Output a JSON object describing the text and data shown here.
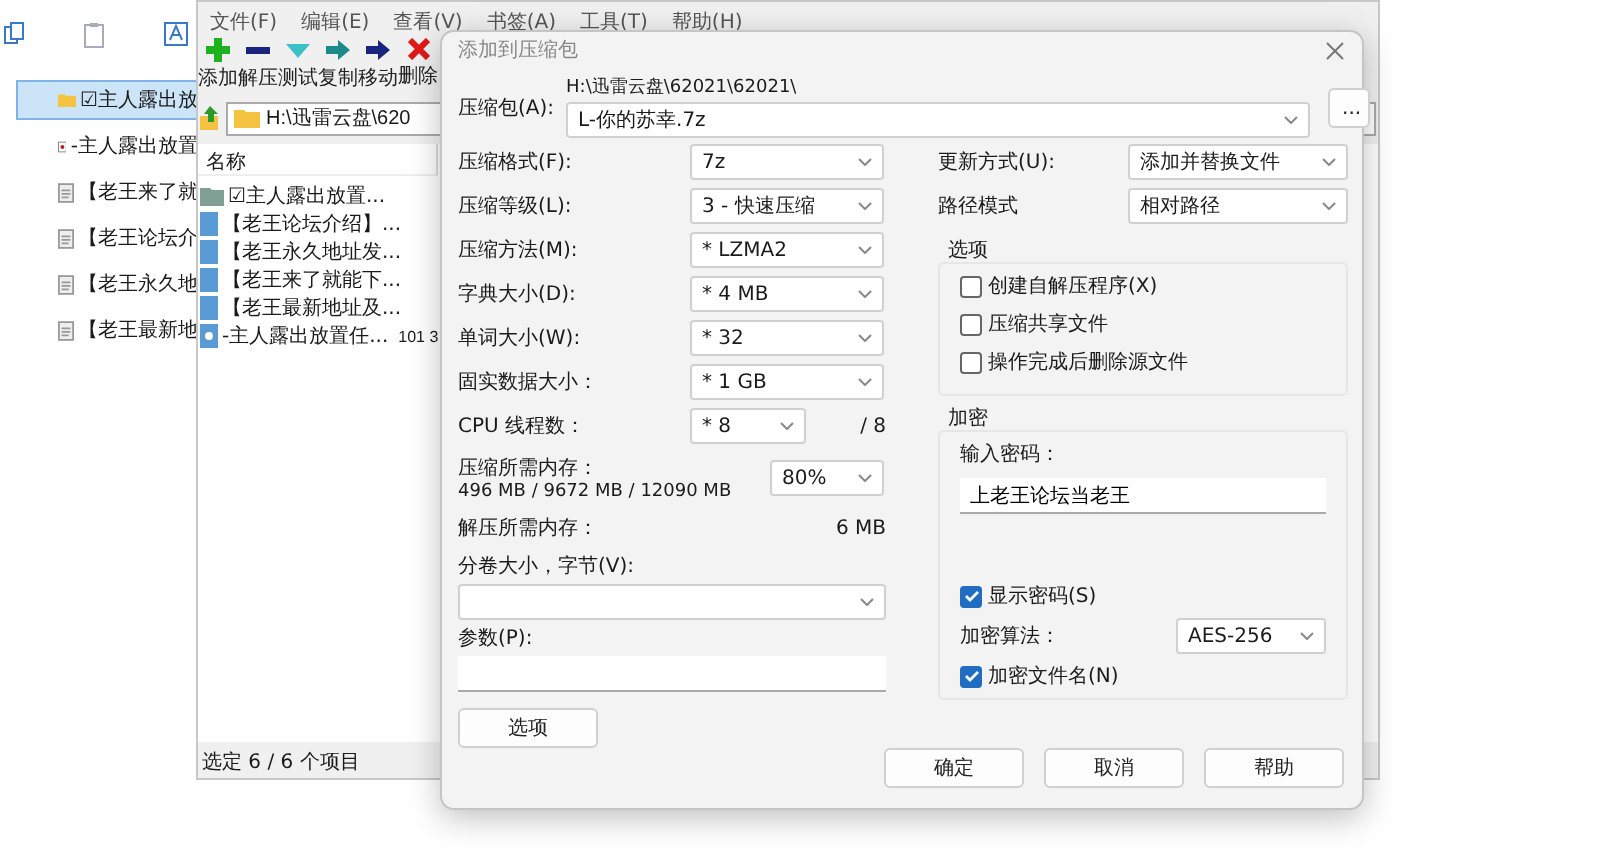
{
  "explorer": {
    "items": [
      {
        "name": "☑主人露出放",
        "kind": "folder",
        "selected": true
      },
      {
        "name": "-主人露出放置",
        "kind": "archive",
        "selected": false
      },
      {
        "name": "【老王来了就",
        "kind": "doc",
        "selected": false
      },
      {
        "name": "【老王论坛介",
        "kind": "doc",
        "selected": false
      },
      {
        "name": "【老王永久地",
        "kind": "doc",
        "selected": false
      },
      {
        "name": "【老王最新地",
        "kind": "doc",
        "selected": false
      }
    ]
  },
  "filemanager": {
    "menu": [
      "文件(F)",
      "编辑(E)",
      "查看(V)",
      "书签(A)",
      "工具(T)",
      "帮助(H)"
    ],
    "toolbar": [
      {
        "label": "添加",
        "kind": "add"
      },
      {
        "label": "解压",
        "kind": "extract"
      },
      {
        "label": "测试",
        "kind": "test"
      },
      {
        "label": "复制",
        "kind": "copy"
      },
      {
        "label": "移动",
        "kind": "move"
      },
      {
        "label": "删除",
        "kind": "delete"
      }
    ],
    "address": "H:\\迅雷云盘\\620",
    "columns": [
      "名称"
    ],
    "rows": [
      {
        "name": "☑主人露出放置...",
        "kind": "folder"
      },
      {
        "name": "【老王论坛介绍】...",
        "kind": "doc"
      },
      {
        "name": "【老王永久地址发...",
        "kind": "doc"
      },
      {
        "name": "【老王来了就能下...",
        "kind": "doc"
      },
      {
        "name": "【老王最新地址及...",
        "kind": "doc"
      },
      {
        "name": "-主人露出放置任...",
        "kind": "archive",
        "size": "101 3"
      }
    ],
    "status": "选定 6 / 6 个项目"
  },
  "dialog": {
    "title": "添加到压缩包",
    "archive": {
      "label": "压缩包(A):",
      "path": "H:\\迅雷云盘\\62021\\62021\\",
      "value": "L-你的苏幸.7z",
      "browse": "..."
    },
    "left": [
      {
        "kind": "combo",
        "label": "压缩格式(F):",
        "value": "7z"
      },
      {
        "kind": "combo",
        "label": "压缩等级(L):",
        "value": "3 - 快速压缩"
      },
      {
        "kind": "combo",
        "label": "压缩方法(M):",
        "value": "* LZMA2"
      },
      {
        "kind": "combo",
        "label": "字典大小(D):",
        "value": "* 4 MB"
      },
      {
        "kind": "combo",
        "label": "单词大小(W):",
        "value": "* 32"
      },
      {
        "kind": "combo",
        "label": "固实数据大小：",
        "value": "* 1 GB"
      },
      {
        "kind": "threads",
        "label": "CPU 线程数：",
        "value": "* 8",
        "suffix": "/ 8"
      },
      {
        "kind": "memory",
        "label": "压缩所需内存：",
        "detail": "496 MB / 9672 MB / 12090 MB",
        "value": "80%"
      },
      {
        "kind": "info",
        "label": "解压所需内存：",
        "value": "6 MB"
      }
    ],
    "split": {
      "label": "分卷大小，字节(V):"
    },
    "params": {
      "label": "参数(P):"
    },
    "options_button": "选项",
    "right": [
      {
        "label": "更新方式(U):",
        "value": "添加并替换文件"
      },
      {
        "label": "路径模式",
        "value": "相对路径"
      }
    ],
    "options": {
      "title": "选项",
      "items": [
        {
          "label": "创建自解压程序(X)",
          "checked": false
        },
        {
          "label": "压缩共享文件",
          "checked": false
        },
        {
          "label": "操作完成后删除源文件",
          "checked": false
        }
      ]
    },
    "encryption": {
      "title": "加密",
      "password_label": "输入密码：",
      "password": "上老王论坛当老王",
      "show_password": {
        "label": "显示密码(S)",
        "checked": true
      },
      "method_label": "加密算法：",
      "method": "AES-256",
      "encrypt_names": {
        "label": "加密文件名(N)",
        "checked": true
      }
    },
    "buttons": [
      "确定",
      "取消",
      "帮助"
    ]
  }
}
